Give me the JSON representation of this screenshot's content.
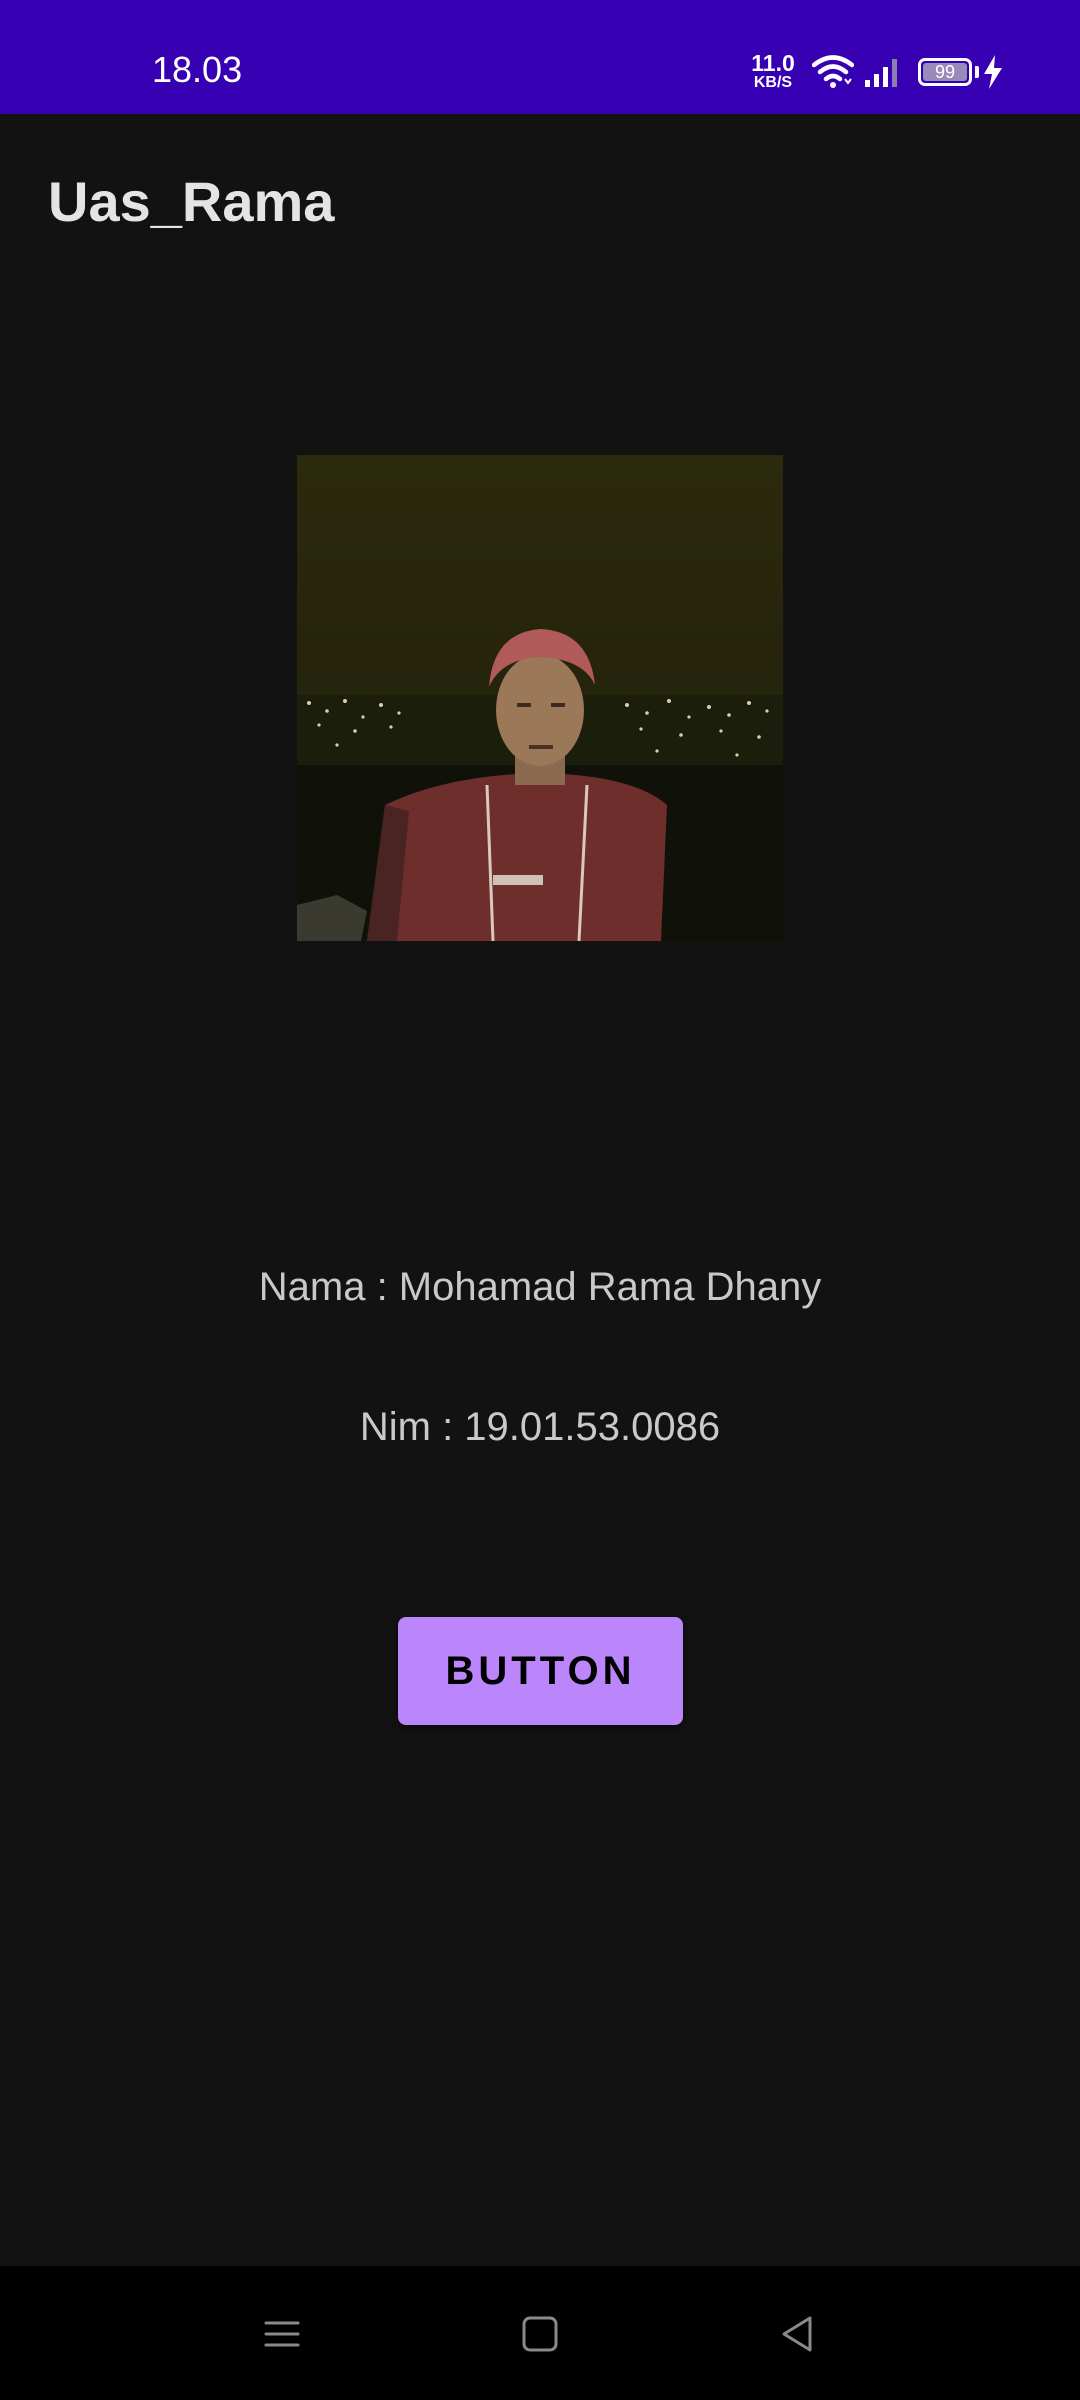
{
  "status_bar": {
    "time": "18.03",
    "net_speed_value": "11.0",
    "net_speed_unit": "KB/S",
    "battery_level": "99",
    "icons": [
      "wifi-icon",
      "signal-icon",
      "battery-icon",
      "charging-bolt-icon"
    ]
  },
  "app_bar": {
    "title": "Uas_Rama"
  },
  "profile": {
    "photo_icon": "profile-photo",
    "name_text": "Nama : Mohamad Rama Dhany",
    "nim_text": "Nim : 19.01.53.0086"
  },
  "button": {
    "label": "BUTTON"
  },
  "nav_bar": {
    "icons": [
      "recents-menu-icon",
      "home-icon",
      "back-icon"
    ]
  },
  "colors": {
    "status_bar": "#3700B3",
    "background": "#121212",
    "button": "#BB86FC",
    "nav_bar": "#000000"
  }
}
